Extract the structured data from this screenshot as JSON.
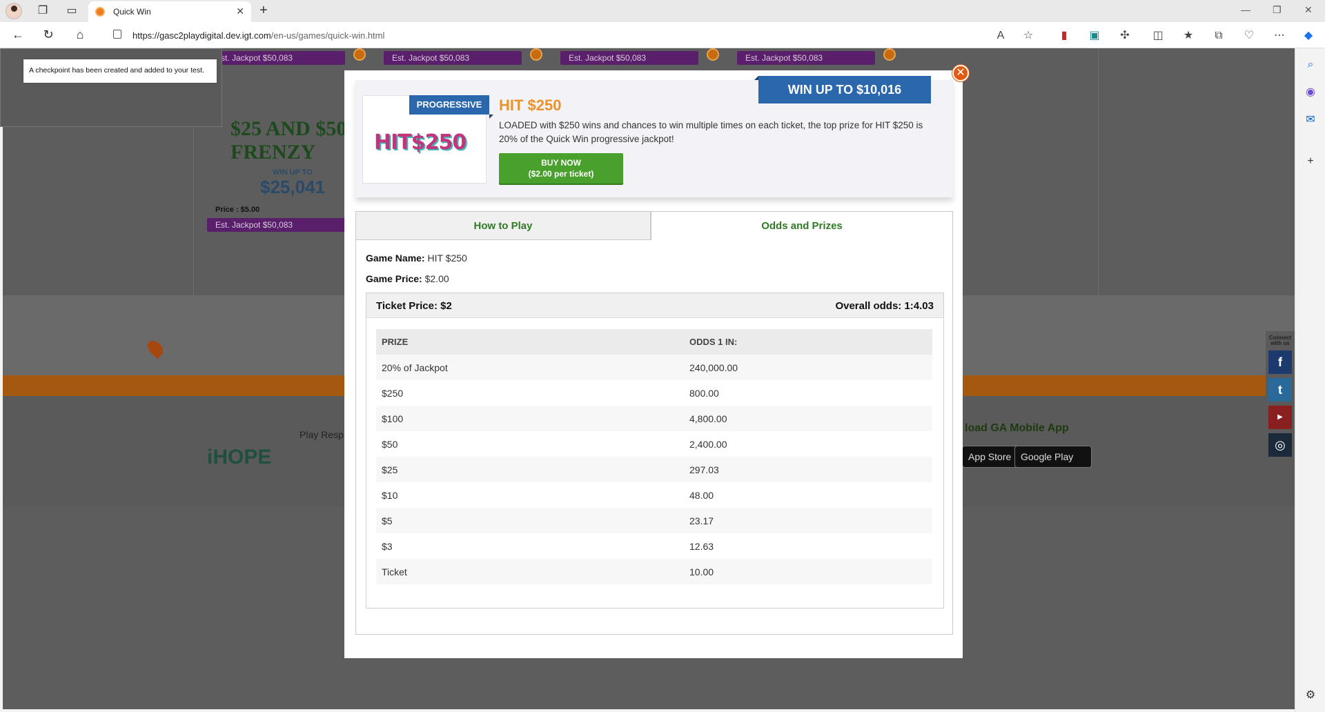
{
  "browser": {
    "tab_title": "Quick Win",
    "url_host": "https://gasc2playdigital.dev.igt.com",
    "url_path": "/en-us/games/quick-win.html"
  },
  "toast": {
    "message": "A checkpoint has been created and added to your test."
  },
  "background": {
    "jackpot_label": "Est. Jackpot $50,083",
    "frenzy_title": "$25 AND $50 FRENZY",
    "frenzy_win_label": "WIN UP TO",
    "frenzy_win_amount": "$25,041",
    "frenzy_price": "Price : $5.00",
    "footer": {
      "ihope": "iHOPE",
      "play_responsibly": "Play Resp",
      "download_app": "load GA Mobile App",
      "app_store": "App Store",
      "google_play": "Google Play",
      "connect": "Connect with us"
    }
  },
  "modal": {
    "win_up_to": "WIN UP TO $10,016",
    "badge": "PROGRESSIVE",
    "logo_text": "HIT$250",
    "title": "HIT $250",
    "description": "LOADED with $250 wins and chances to win multiple times on each ticket, the top prize for HIT $250 is 20% of the Quick Win progressive jackpot!",
    "buy_line1": "BUY NOW",
    "buy_line2": "($2.00 per ticket)",
    "tabs": [
      "How to Play",
      "Odds and Prizes"
    ],
    "game_name_label": "Game Name:",
    "game_name": "HIT $250",
    "game_price_label": "Game Price:",
    "game_price": "$2.00",
    "ticket_price": "Ticket Price: $2",
    "overall_odds": "Overall odds: 1:4.03",
    "table_headers": [
      "PRIZE",
      "ODDS 1 IN:"
    ],
    "rows": [
      {
        "prize": "20% of Jackpot",
        "odds": "240,000.00"
      },
      {
        "prize": "$250",
        "odds": "800.00"
      },
      {
        "prize": "$100",
        "odds": "4,800.00"
      },
      {
        "prize": "$50",
        "odds": "2,400.00"
      },
      {
        "prize": "$25",
        "odds": "297.03"
      },
      {
        "prize": "$10",
        "odds": "48.00"
      },
      {
        "prize": "$5",
        "odds": "23.17"
      },
      {
        "prize": "$3",
        "odds": "12.63"
      },
      {
        "prize": "Ticket",
        "odds": "10.00"
      }
    ]
  },
  "colors": {
    "accent_blue": "#2a67ad",
    "title_orange": "#e8942c",
    "buy_green": "#4aa02c",
    "tab_green": "#2f7a25",
    "jackpot_purple": "#5a1f6a"
  }
}
